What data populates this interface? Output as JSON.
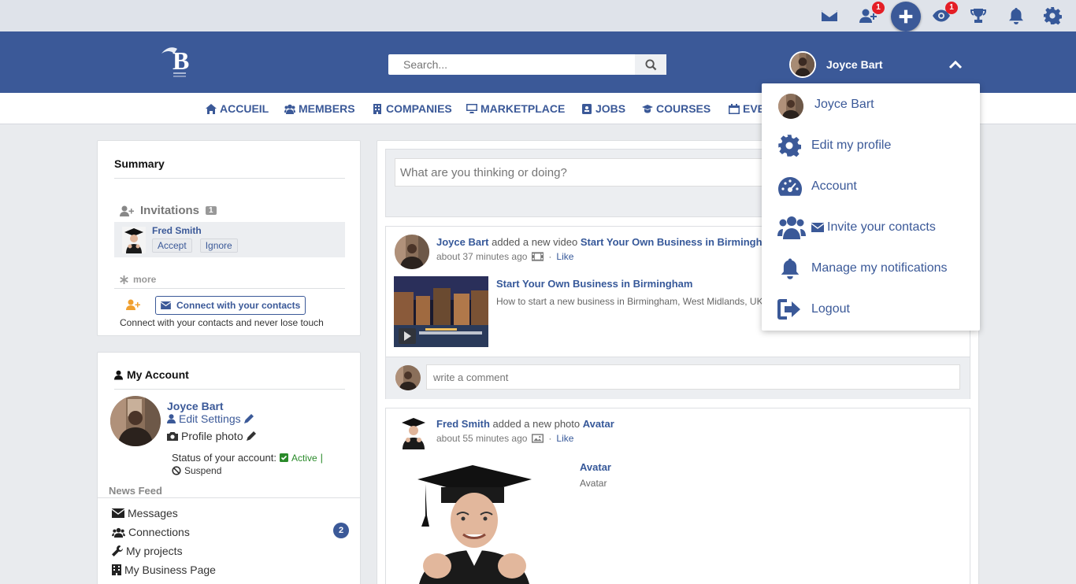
{
  "topbar": {
    "friend_badge": "1",
    "visits_badge": "1"
  },
  "header": {
    "search_placeholder": "Search...",
    "user_name": "Joyce Bart"
  },
  "nav": {
    "items": [
      "ACCUEIL",
      "MEMBERS",
      "COMPANIES",
      "MARKETPLACE",
      "JOBS",
      "COURSES",
      "EVE"
    ]
  },
  "summary": {
    "title": "Summary",
    "invitations_label": "Invitations",
    "invitations_count": "1",
    "invite_name": "Fred Smith",
    "accept": "Accept",
    "ignore": "Ignore",
    "more": "more",
    "connect_button": "Connect with your contacts",
    "connect_note": "Connect with your contacts and never lose touch"
  },
  "account": {
    "title": "My Account",
    "name": "Joyce Bart",
    "edit_settings": "Edit Settings",
    "profile_photo": "Profile photo",
    "status_label": "Status of your account:",
    "active": "Active",
    "separator": "|",
    "suspend": "Suspend",
    "news_feed": "News Feed",
    "menu": [
      "Messages",
      "Connections",
      "My projects",
      "My Business Page"
    ],
    "connections_count": "2"
  },
  "composer": {
    "placeholder": "What are you thinking or doing?"
  },
  "post1": {
    "author": "Joyce Bart",
    "action": "added a new video",
    "target": "Start Your Own Business in Birmingham",
    "time": "about 37 minutes ago",
    "dot": "·",
    "like": "Like",
    "video_title": "Start Your Own Business in Birmingham",
    "video_desc": "How to start a new business in Birmingham, West Midlands, UK",
    "comment_placeholder": "write a comment"
  },
  "post2": {
    "author": "Fred Smith",
    "action": "added a new photo",
    "target": "Avatar",
    "time": "about 55 minutes ago",
    "dot": "·",
    "like": "Like",
    "photo_title": "Avatar",
    "photo_desc": "Avatar"
  },
  "dropdown": {
    "items": [
      "Joyce Bart",
      "Edit my profile",
      "Account",
      "Invite your contacts",
      "Manage my notifications",
      "Logout"
    ]
  },
  "colors": {
    "brand": "#3b5998",
    "badge": "#e41e26",
    "active": "#2a8a2a"
  }
}
